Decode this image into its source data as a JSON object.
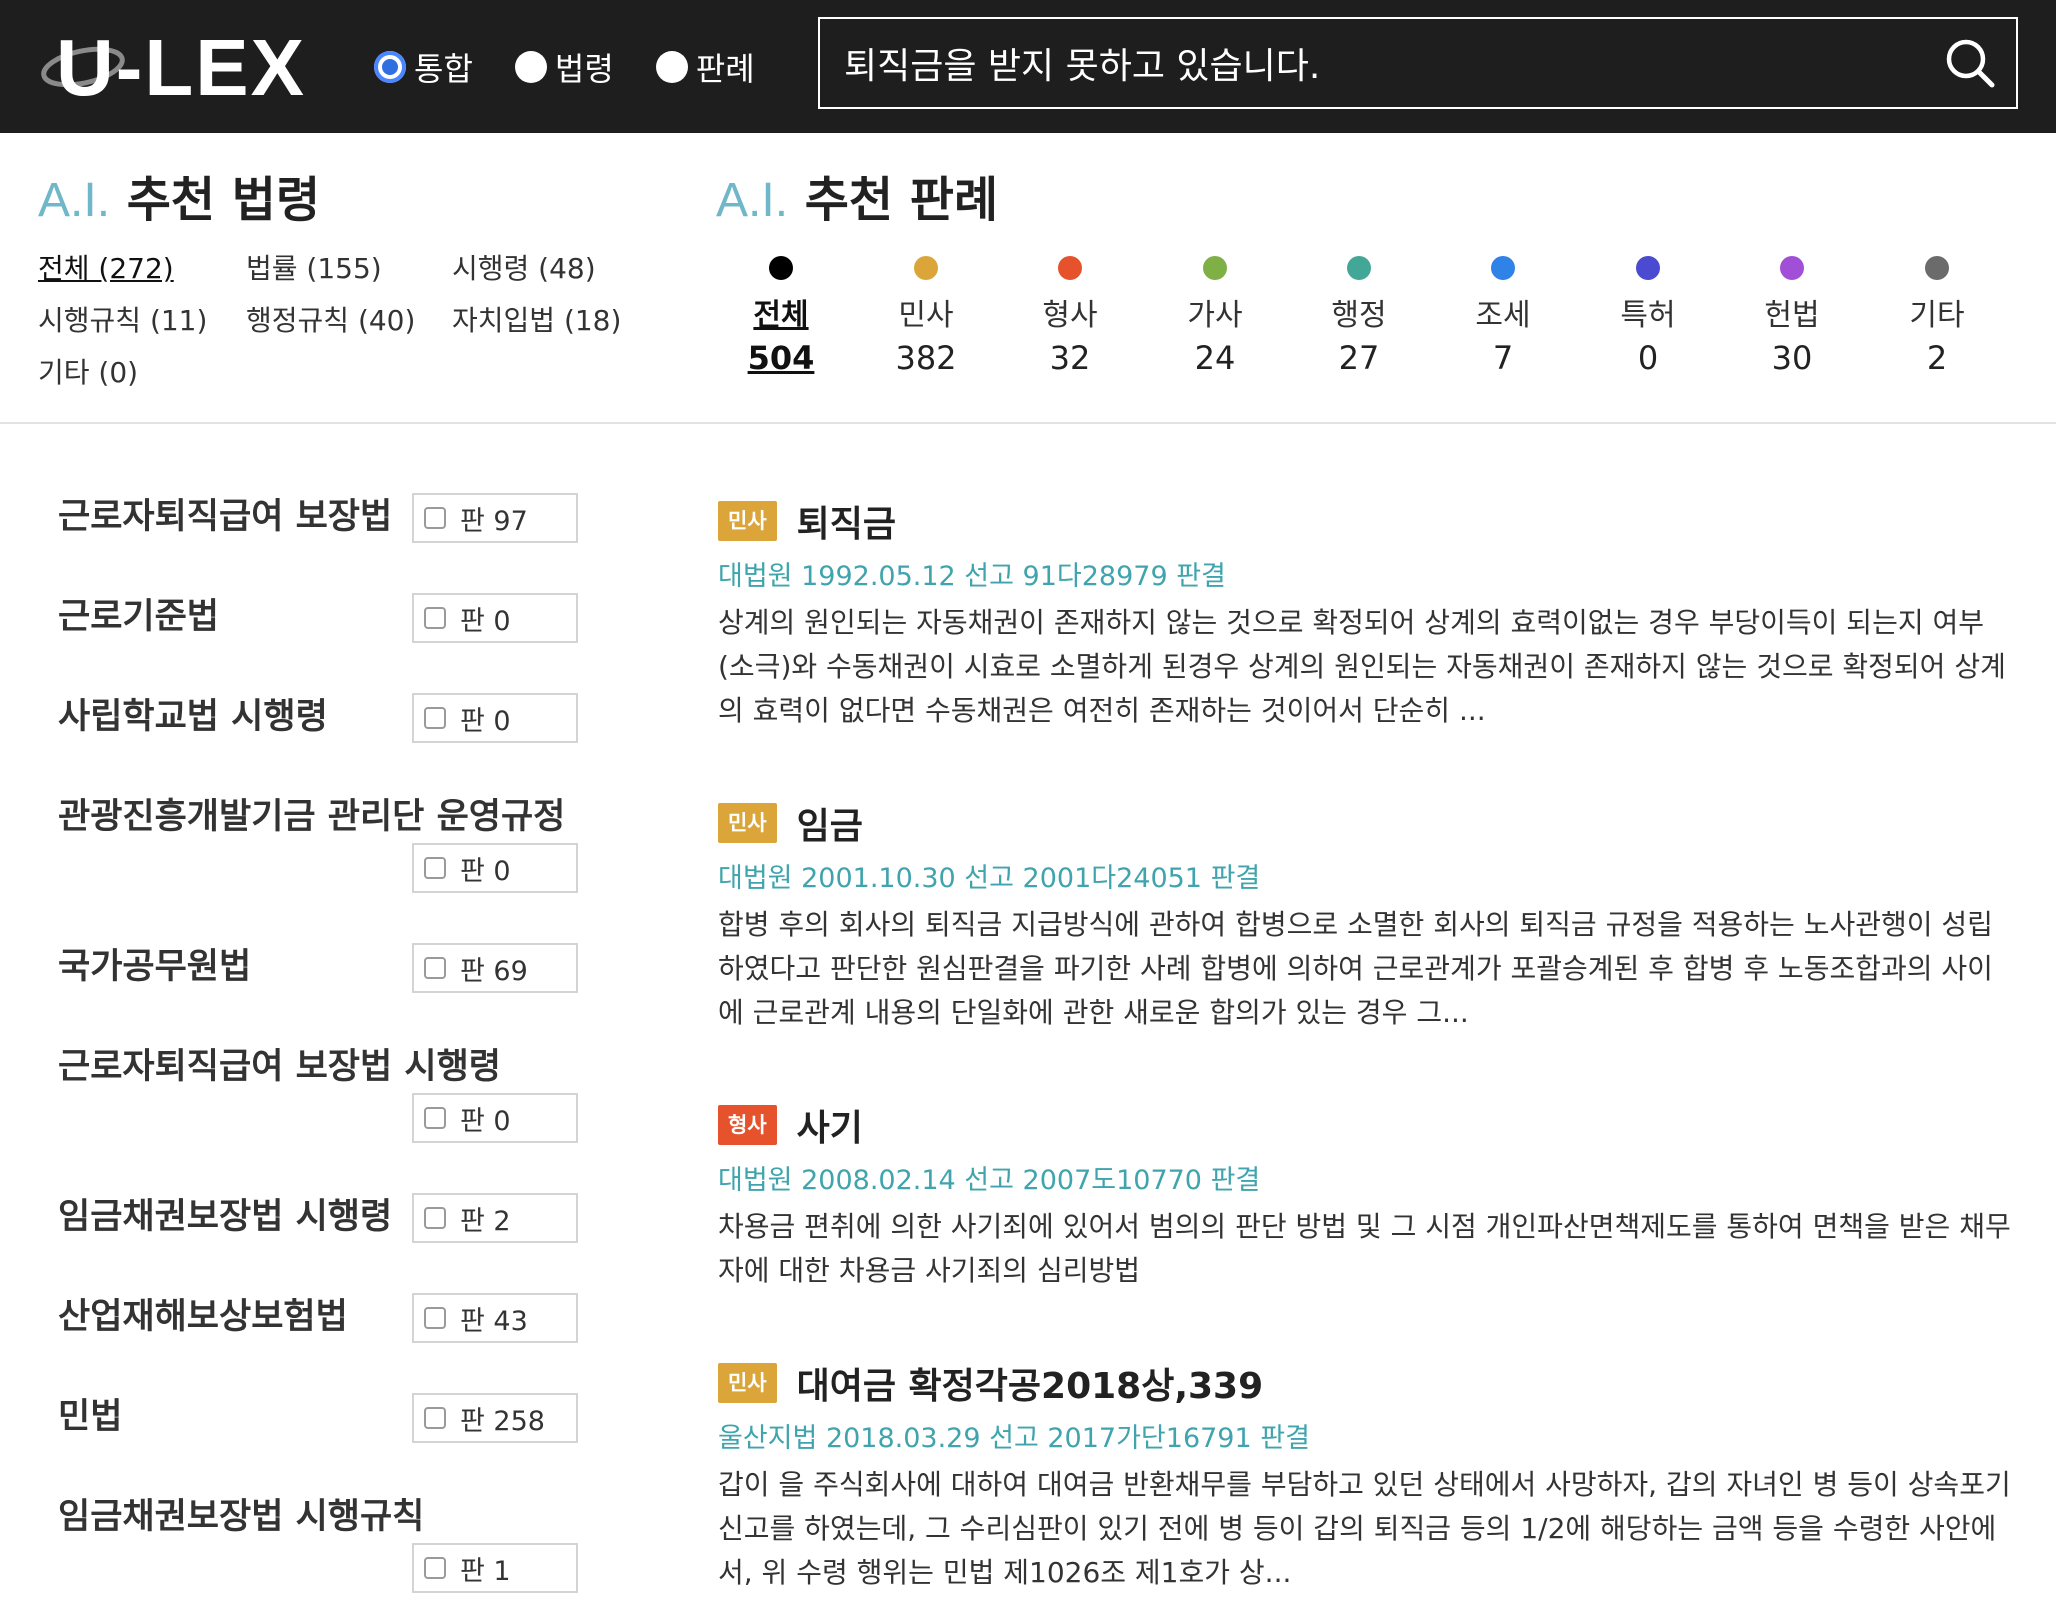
{
  "header": {
    "logo_text": "U-LEX",
    "radios": [
      {
        "label": "통합",
        "checked": true
      },
      {
        "label": "법령",
        "checked": false
      },
      {
        "label": "판례",
        "checked": false
      }
    ],
    "search": {
      "value": "퇴직금을 받지 못하고 있습니다.",
      "icon": "search-icon"
    }
  },
  "law_section": {
    "title_prefix": "A.I.",
    "title": "추천 법령",
    "categories": [
      {
        "label": "전체 (272)",
        "active": true
      },
      {
        "label": "법률 (155)",
        "active": false
      },
      {
        "label": "시행령 (48)",
        "active": false
      },
      {
        "label": "시행규칙 (11)",
        "active": false
      },
      {
        "label": "행정규칙 (40)",
        "active": false
      },
      {
        "label": "자치입법 (18)",
        "active": false
      },
      {
        "label": "기타 (0)",
        "active": false
      }
    ],
    "laws": [
      {
        "name": "근로자퇴직급여 보장법",
        "count": "판 97"
      },
      {
        "name": "근로기준법",
        "count": "판 0"
      },
      {
        "name": "사립학교법 시행령",
        "count": "판 0"
      },
      {
        "name": "관광진흥개발기금 관리단 운영규정",
        "count": "판 0"
      },
      {
        "name": "국가공무원법",
        "count": "판 69"
      },
      {
        "name": "근로자퇴직급여 보장법 시행령",
        "count": "판 0"
      },
      {
        "name": "임금채권보장법 시행령",
        "count": "판 2"
      },
      {
        "name": "산업재해보상보험법",
        "count": "판 43"
      },
      {
        "name": "민법",
        "count": "판 258"
      },
      {
        "name": "임금채권보장법 시행규칙",
        "count": "판 1"
      }
    ]
  },
  "precedent_section": {
    "title_prefix": "A.I.",
    "title": "추천 판례",
    "categories": [
      {
        "label": "전체",
        "count": "504",
        "color": "#000000",
        "active": true
      },
      {
        "label": "민사",
        "count": "382",
        "color": "#dba53a",
        "active": false
      },
      {
        "label": "형사",
        "count": "32",
        "color": "#e5522c",
        "active": false
      },
      {
        "label": "가사",
        "count": "24",
        "color": "#7fb046",
        "active": false
      },
      {
        "label": "행정",
        "count": "27",
        "color": "#43a797",
        "active": false
      },
      {
        "label": "조세",
        "count": "7",
        "color": "#2f82e6",
        "active": false
      },
      {
        "label": "특허",
        "count": "0",
        "color": "#4a4bd0",
        "active": false
      },
      {
        "label": "헌법",
        "count": "30",
        "color": "#a04fd6",
        "active": false
      },
      {
        "label": "기타",
        "count": "2",
        "color": "#6b6b6b",
        "active": false
      }
    ],
    "cases": [
      {
        "badge": "민사",
        "badge_type": "minsa",
        "title": "퇴직금",
        "citation": "대법원 1992.05.12 선고 91다28979 판결",
        "summary": "상계의 원인되는 자동채권이 존재하지 않는 것으로 확정되어 상계의 효력이없는 경우 부당이득이 되는지 여부(소극)와 수동채권이 시효로 소멸하게 된경우 상계의 원인되는 자동채권이 존재하지 않는 것으로 확정되어 상계의 효력이 없다면 수동채권은 여전히 존재하는 것이어서 단순히 ..."
      },
      {
        "badge": "민사",
        "badge_type": "minsa",
        "title": "임금",
        "citation": "대법원 2001.10.30 선고 2001다24051 판결",
        "summary": "합병 후의 회사의 퇴직금 지급방식에 관하여 합병으로 소멸한 회사의 퇴직금 규정을 적용하는 노사관행이 성립하였다고 판단한 원심판결을 파기한 사례 합병에 의하여 근로관계가 포괄승계된 후 합병 후 노동조합과의 사이에 근로관계 내용의 단일화에 관한 새로운 합의가 있는 경우 그..."
      },
      {
        "badge": "형사",
        "badge_type": "hyeongsa",
        "title": "사기",
        "citation": "대법원 2008.02.14 선고 2007도10770 판결",
        "summary": "차용금 편취에 의한 사기죄에 있어서 범의의 판단 방법 및 그 시점 개인파산면책제도를 통하여 면책을 받은 채무자에 대한 차용금 사기죄의 심리방법"
      },
      {
        "badge": "민사",
        "badge_type": "minsa",
        "title": "대여금 확정각공2018상,339",
        "citation": "울산지법 2018.03.29 선고 2017가단16791 판결",
        "summary": "갑이 을 주식회사에 대하여 대여금 반환채무를 부담하고 있던 상태에서 사망하자, 갑의 자녀인 병 등이 상속포기신고를 하였는데, 그 수리심판이 있기 전에 병 등이 갑의 퇴직금 등의 1/2에 해당하는 금액 등을 수령한 사안에서, 위 수령 행위는 민법 제1026조 제1호가 상..."
      }
    ]
  }
}
